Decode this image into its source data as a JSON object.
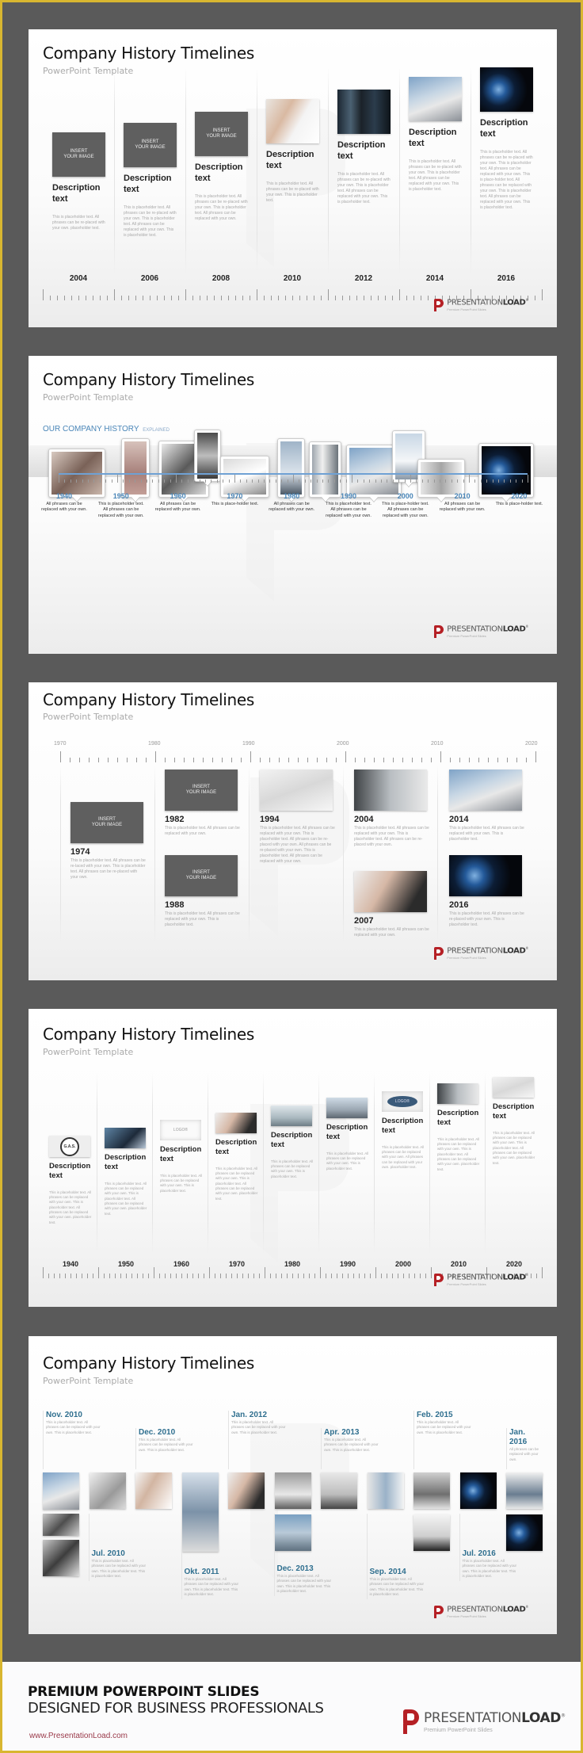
{
  "common": {
    "slide_title": "Company History Timelines",
    "slide_subtitle": "PowerPoint Template",
    "logo_name_light": "PRESENTATION",
    "logo_name_bold": "LOAD",
    "logo_reg": "®",
    "logo_tagline": "Premium PowerPoint Slides",
    "insert_image_label": "INSERT YOUR IMAGE"
  },
  "colors": {
    "frame_border": "#d8b630",
    "background": "#5a5a5a",
    "brand_red": "#b52025",
    "accent_blue": "#4a86b8",
    "date_teal": "#2f6f8f"
  },
  "slide1": {
    "columns": [
      {
        "year": "2004",
        "media": "insert-image",
        "heading": "Description text",
        "body": "This is placeholder text. All phrases can be re-placed with your own. placeholder text."
      },
      {
        "year": "2006",
        "media": "insert-image",
        "heading": "Description text",
        "body": "This is placeholder text. All phrases can be re-placed with your own. This is placeholder text. All phrases can be replaced with your own. This is placeholder text."
      },
      {
        "year": "2008",
        "media": "insert-image",
        "heading": "Description text",
        "body": "This is placeholder text. All phrases can be re-placed with your own. This is placeholder text. All phrases can be replaced with your own."
      },
      {
        "year": "2010",
        "media": "photo-man-drawing-chart",
        "heading": "Description text",
        "body": "This is placeholder text. All phrases can be re-placed with your own. This is placeholder text."
      },
      {
        "year": "2012",
        "media": "photo-server-room",
        "heading": "Description text",
        "body": "This is placeholder text. All phrases can be re-placed with your own. This is placeholder text. All phrases can be replaced with your own. This is placeholder text."
      },
      {
        "year": "2014",
        "media": "photo-office-building",
        "heading": "Description text",
        "body": "This is placeholder text. All phrases can be re-placed with your own. This is placeholder text. All phrases can be replaced with your own. This is placeholder text."
      },
      {
        "year": "2016",
        "media": "photo-camera-lens",
        "heading": "Description text",
        "body": "This is placeholder text. All phrases can be re-placed with your own. This is placeholder text. All phrases can be replaced with your own. This is place-holder text. All phrases can be replaced with your own. This is placeholder text. All phrases can be replaced with your own. This is placeholder text."
      }
    ]
  },
  "slide2": {
    "heading": "OUR COMPANY HISTORY",
    "heading_suffix": "EXPLAINED",
    "photos": [
      "photo-workers-vintage",
      "photo-vintage-portrait",
      "photo-motorcycle",
      "photo-vintage-street",
      "photo-vintage-car",
      "photo-bridge",
      "photo-modern-building",
      "photo-office-building",
      "photo-glass-roof",
      "photo-corridor",
      "photo-camera-lens"
    ],
    "milestones": [
      {
        "year": "1940",
        "text": "All phrases can be replaced with your own."
      },
      {
        "year": "1950",
        "text": "This is placeholder text. All phrases can be replaced with your own."
      },
      {
        "year": "1960",
        "text": "All phrases can be replaced with your own."
      },
      {
        "year": "1970",
        "text": "This is place-holder text."
      },
      {
        "year": "1980",
        "text": "All phrases can be replaced with your own."
      },
      {
        "year": "1990",
        "text": "This is placeholder text. All phrases can be replaced with your own."
      },
      {
        "year": "2000",
        "text": "This is place-holder text. All phrases can be replaced with your own."
      },
      {
        "year": "2010",
        "text": "All phrases can be replaced with your own."
      },
      {
        "year": "2020",
        "text": "This is place-holder text."
      }
    ]
  },
  "slide3": {
    "axis_labels": [
      "1970",
      "1980",
      "1990",
      "2000",
      "2010",
      "2020"
    ],
    "entries": [
      {
        "year": "1974",
        "media": "insert-image",
        "text": "This is placeholder text. All phrases can be re-laced with your own. This is placeholder text. All phrases can be re-placed with your own."
      },
      {
        "year": "1982",
        "media": "insert-image",
        "text": "This is placeholder text. All phrases can be replaced with your own."
      },
      {
        "year": "1988",
        "media": "insert-image",
        "text": "This is placeholder text. All phrases can be replaced with your own. This is placeholder text."
      },
      {
        "year": "1994",
        "media": "photo-chart-paper",
        "text": "This is placeholder text. All phrases can be replaced with your own. This is placeholder text. All phrases can be re-placed with your own. All phrases can be re-placed with your own. This is placeholder text. All phrases can be replaced with your own."
      },
      {
        "year": "2004",
        "media": "photo-office-man",
        "text": "This is placeholder text. All phrases can be replaced with your own. This is placeholder text. All phrases can be re-placed with your own."
      },
      {
        "year": "2007",
        "media": "photo-team-laptop",
        "text": "This is placeholder text. All phrases can be replaced with your own."
      },
      {
        "year": "2014",
        "media": "photo-office-building",
        "text": "This is placeholder text. All phrases can be replaced with your own. This is placeholder text."
      },
      {
        "year": "2016",
        "media": "photo-camera-lens",
        "text": "This is placeholder text. All phrases can be re-placed with your own. This is placeholder text."
      }
    ]
  },
  "slide4": {
    "logo_label": "LOGO®",
    "seal_label": "G.A.S.",
    "columns": [
      {
        "year": "1940",
        "media": "seal-logo",
        "heading": "Description text",
        "body": "This is placeholder text. All phrases can be replaced with your own. This is placeholder text. All phrases can be replaced with your own. placeholder text."
      },
      {
        "year": "1950",
        "media": "photo-handshake",
        "heading": "Description text",
        "body": "This is placeholder text. All phrases can be replaced with your own. This is placeholder text. All phrases can be replaced with your own. placeholder text."
      },
      {
        "year": "1960",
        "media": "logo-box",
        "heading": "Description text",
        "body": "This is placeholder text. All phrases can be replaced with your own. This is placeholder text."
      },
      {
        "year": "1970",
        "media": "photo-team-laptop",
        "heading": "Description text",
        "body": "This is placeholder text. All phrases can be replaced with your own. This is placeholder text. All phrases can be replaced with your own. placeholder text."
      },
      {
        "year": "1980",
        "media": "photo-glass-hall",
        "heading": "Description text",
        "body": "This is placeholder text. All phrases can be replaced with your own. This is placeholder text."
      },
      {
        "year": "1990",
        "media": "photo-building-sky",
        "heading": "Description text",
        "body": "This is placeholder text. All phrases can be replaced with your own. This is placeholder text."
      },
      {
        "year": "2000",
        "media": "logo-oval",
        "heading": "Description text",
        "body": "This is placeholder text. All phrases can be replaced with your own. All phrases can be replaced with your own. placeholder text."
      },
      {
        "year": "2010",
        "media": "photo-office-man",
        "heading": "Description text",
        "body": "This is placeholder text. All phrases can be replaced with your own. This is placeholder text. All phrases can be replaced with your own. placeholder text."
      },
      {
        "year": "2020",
        "media": "photo-chart-paper",
        "heading": "Description text",
        "body": "This is placeholder text. All phrases can be replaced with your own. This is placeholder text. All phrases can be replaced with your own. placeholder text."
      }
    ]
  },
  "slide5": {
    "top_dates": [
      {
        "date": "Nov. 2010",
        "text": "This is placeholder text. All phrases can be replaced with your own. This is placeholder text."
      },
      {
        "date": "Dec. 2010",
        "text": "This is placeholder text. All phrases can be replaced with your own. This is placeholder text."
      },
      {
        "date": "Jan. 2012",
        "text": "This is placeholder text. All phrases can be replaced with your own. This is placeholder text."
      },
      {
        "date": "Apr. 2013",
        "text": "This is placeholder text. All phrases can be replaced with your own. This is placeholder text."
      },
      {
        "date": "Feb. 2015",
        "text": "This is placeholder text. All phrases can be replaced with your own. This is placeholder text."
      },
      {
        "date": "Jan. 2016",
        "text": "All phrases can be replaced with your own."
      }
    ],
    "bottom_dates": [
      {
        "date": "Jul. 2010",
        "text": "This is placeholder text. All phrases can be replaced with your own. This is placeholder text. This is placeholder text."
      },
      {
        "date": "Okt. 2011",
        "text": "This is placeholder text. All phrases can be replaced with your own. This is placeholder text. This is placeholder text."
      },
      {
        "date": "Dec. 2013",
        "text": "This is placeholder text. All phrases can be replaced with your own. This is placeholder text. This is placeholder text."
      },
      {
        "date": "Sep. 2014",
        "text": "This is placeholder text. All phrases can be replaced with your own. This is placeholder text. This is placeholder text."
      },
      {
        "date": "Jul. 2016",
        "text": "This is placeholder text. All phrases can be replaced with your own. This is placeholder text. This is placeholder text."
      }
    ]
  },
  "footer": {
    "title": "PREMIUM POWERPOINT SLIDES",
    "subtitle": "DESIGNED FOR BUSINESS PROFESSIONALS",
    "url": "www.PresentationLoad.com"
  }
}
